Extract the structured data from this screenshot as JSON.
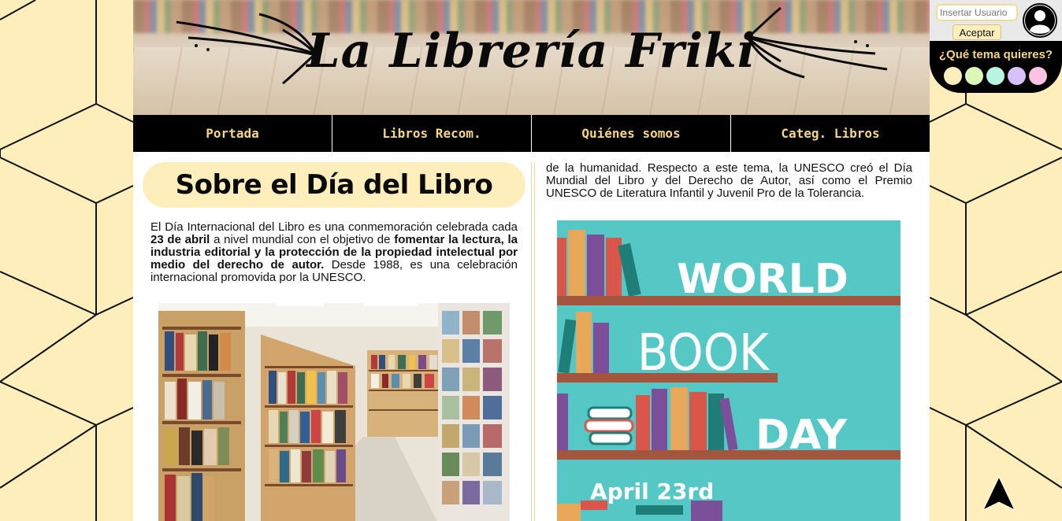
{
  "header": {
    "title": "La Librería Friki"
  },
  "nav": {
    "items": [
      {
        "label": "Portada"
      },
      {
        "label": "Libros Recom."
      },
      {
        "label": "Quiénes somos"
      },
      {
        "label": "Categ. Libros"
      }
    ]
  },
  "user": {
    "input_placeholder": "Insertar Usuario",
    "accept_label": "Aceptar"
  },
  "theme": {
    "label": "¿Qué tema quieres?",
    "swatches": [
      "#fdeebc",
      "#dcf8b8",
      "#b9f5e4",
      "#d8c1fb",
      "#fcc2e2"
    ]
  },
  "article": {
    "heading": "Sobre el Día del Libro",
    "intro_1": "El Día Internacional del Libro es una conmemoración celebrada cada ",
    "intro_bold_1": "23 de abril",
    "intro_2": " a nivel mundial con el objetivo de ",
    "intro_bold_2": "fomentar la lectura, la industria editorial y la protección de la propiedad intelectual por medio del derecho de autor.",
    "intro_3": " Desde 1988, es una celebración internacional promovida por la UNESCO.",
    "right_text": "de la humanidad. Respecto a este tema, la UNESCO creó el Día Mundial del Libro y del Derecho de Autor, así como el Premio UNESCO de Literatura Infantil y Juvenil Pro de la Tolerancia."
  },
  "poster": {
    "line1": "WORLD",
    "line2": "BOOK",
    "line3": "DAY",
    "date": "April 23rd"
  }
}
